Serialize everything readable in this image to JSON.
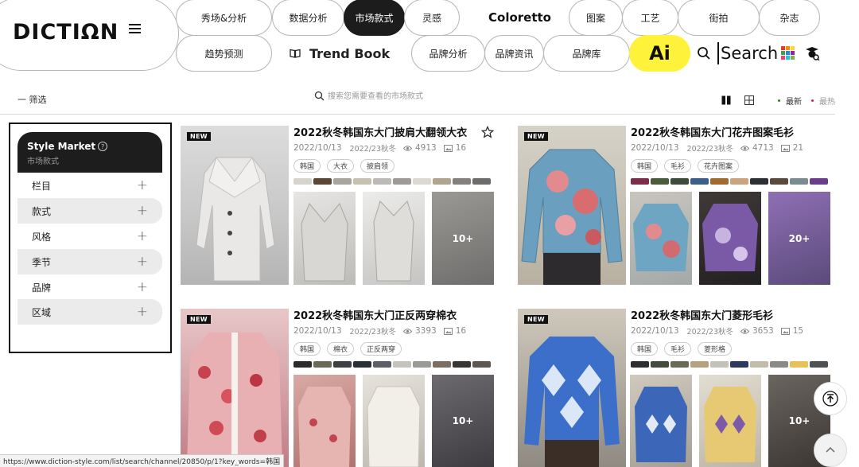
{
  "header": {
    "logo": "DICTIΩN",
    "nav_top": [
      "秀场&分析",
      "数据分析",
      "市场款式",
      "灵感",
      "Coloretto",
      "图案",
      "工艺",
      "街拍",
      "杂志"
    ],
    "nav_bottom": [
      "趋势预测",
      "Trend Book",
      "品牌分析",
      "品牌资讯",
      "品牌库"
    ],
    "ai_label": "Ai",
    "search_label": "Search",
    "active_tab": "市场款式",
    "grid_colors": [
      "#e53935",
      "#fb8c00",
      "#fdd835",
      "#43a047",
      "#1e88e5",
      "#8e24aa",
      "#ec407a",
      "#26c6da",
      "#7cb342"
    ]
  },
  "toolbar": {
    "filter_label": "一 筛选",
    "search_placeholder": "搜索您需要查看的市场款式",
    "sort_new": "最新",
    "sort_hot": "最热",
    "sort_new_color": "#2e7d32",
    "sort_hot_color": "#d81b60"
  },
  "sidebar": {
    "title": "Style Market",
    "subtitle": "市场款式",
    "items": [
      "栏目",
      "款式",
      "风格",
      "季节",
      "品牌",
      "区域"
    ]
  },
  "cards": [
    {
      "badge": "NEW",
      "title": "2022秋冬韩国东大门披肩大翻领大衣",
      "date": "2022/10/13",
      "season": "2022/23秋冬",
      "views": "4913",
      "images": "16",
      "tags": [
        "韩国",
        "大衣",
        "披肩领"
      ],
      "swatches": [
        "#d7d3cd",
        "#5b4636",
        "#a8a59f",
        "#c8c1b2",
        "#bbbab6",
        "#9d9a97",
        "#dcd8d2",
        "#b1a48f",
        "#83807d",
        "#6d6c6b"
      ],
      "more": "10+"
    },
    {
      "badge": "NEW",
      "title": "2022秋冬韩国东大门花卉图案毛衫",
      "date": "2022/10/13",
      "season": "2022/23秋冬",
      "views": "4713",
      "images": "21",
      "tags": [
        "韩国",
        "毛衫",
        "花卉图案"
      ],
      "swatches": [
        "#7b2d4a",
        "#4a5d3a",
        "#3d4b3b",
        "#3b5e8a",
        "#a06b2e",
        "#c9a47d",
        "#2d3033",
        "#5a4a3c",
        "#7a8b92",
        "#6b3e8c"
      ],
      "more": "20+"
    },
    {
      "badge": "NEW",
      "title": "2022秋冬韩国东大门正反两穿棉衣",
      "date": "2022/10/13",
      "season": "2022/23秋冬",
      "views": "3393",
      "images": "16",
      "tags": [
        "韩国",
        "棉衣",
        "正反两穿"
      ],
      "swatches": [
        "#2b2b2b",
        "#6b6a5a",
        "#3c3f44",
        "#2a2e39",
        "#5c5f68",
        "#c4c2bd",
        "#9a9a97",
        "#7a6e64",
        "#3a3634",
        "#5e5650"
      ],
      "more": "10+"
    },
    {
      "badge": "NEW",
      "title": "2022秋冬韩国东大门菱形毛衫",
      "date": "2022/10/13",
      "season": "2022/23秋冬",
      "views": "3653",
      "images": "15",
      "tags": [
        "韩国",
        "毛衫",
        "菱形格"
      ],
      "swatches": [
        "#2d2e30",
        "#434a3e",
        "#6b6b55",
        "#b3a27a",
        "#c4c1b8",
        "#2c3a5e",
        "#c4bca9",
        "#8a8a86",
        "#e6c25a",
        "#4f5155"
      ],
      "more": "10+"
    }
  ],
  "status_url": "https://www.diction-style.com/list/search/channel/20850/p/1?key_words=韩国"
}
